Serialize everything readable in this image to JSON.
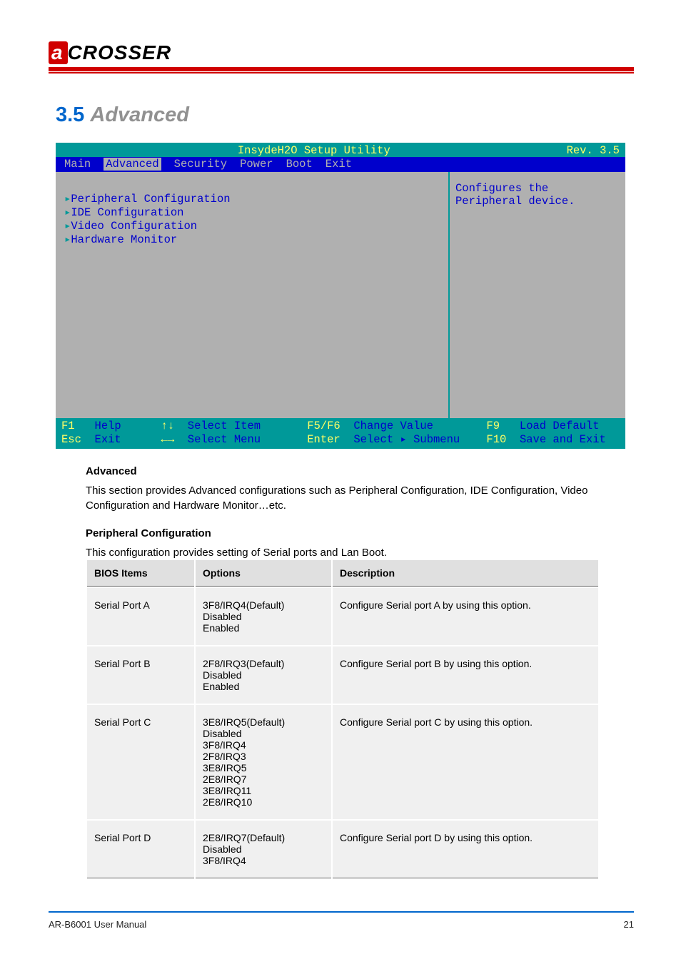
{
  "logo": {
    "highlight": "a",
    "rest": "CROSSER"
  },
  "section": {
    "number": "3.5",
    "title": "Advanced"
  },
  "bios": {
    "utility_name": "InsydeH2O Setup Utility",
    "revision": "Rev. 3.5",
    "tabs": [
      "Main",
      "Advanced",
      "Security",
      "Power",
      "Boot",
      "Exit"
    ],
    "active_tab": "Advanced",
    "menu_items": [
      "Peripheral Configuration",
      "IDE Configuration",
      "Video Configuration",
      "Hardware Monitor"
    ],
    "help_text_line1": "Configures the",
    "help_text_line2": "Peripheral device.",
    "footer": {
      "f1": "F1",
      "f1_label": "Help",
      "updown": "↑↓",
      "updown_label": "Select Item",
      "f5f6": "F5/F6",
      "f5f6_label": "Change Value",
      "f9": "F9",
      "f9_label": "Load Default",
      "esc": "Esc",
      "esc_label": "Exit",
      "leftright": "←→",
      "leftright_label": "Select Menu",
      "enter": "Enter",
      "enter_label": "Select ▸ Submenu",
      "f10": "F10",
      "f10_label": "Save and Exit"
    }
  },
  "paragraph1": {
    "title": "Advanced",
    "body": "This section provides Advanced configurations such as Peripheral Configuration, IDE Configuration, Video Configuration and Hardware Monitor…etc."
  },
  "paragraph2": {
    "title": "Peripheral Configuration",
    "body": "This configuration provides setting of Serial ports and Lan Boot."
  },
  "table": {
    "headers": [
      "BIOS Items",
      "Options",
      "Description"
    ],
    "rows": [
      {
        "item": "Serial Port A",
        "options": "3F8/IRQ4(Default)\nDisabled\nEnabled",
        "desc": "Configure Serial port A by using this option."
      },
      {
        "item": "Serial Port B",
        "options": "2F8/IRQ3(Default)\nDisabled\nEnabled",
        "desc": "Configure Serial port B by using this option."
      },
      {
        "item": "Serial Port C",
        "options": "3E8/IRQ5(Default)\nDisabled\n3F8/IRQ4\n2F8/IRQ3\n3E8/IRQ5\n2E8/IRQ7\n3E8/IRQ11\n2E8/IRQ10",
        "desc": "Configure Serial port C by using this option."
      },
      {
        "item": "Serial Port D",
        "options": "2E8/IRQ7(Default)\nDisabled\n3F8/IRQ4",
        "desc": "Configure Serial port D by using this option."
      }
    ]
  },
  "footer": {
    "left": "AR-B6001 User Manual",
    "right": "21"
  }
}
